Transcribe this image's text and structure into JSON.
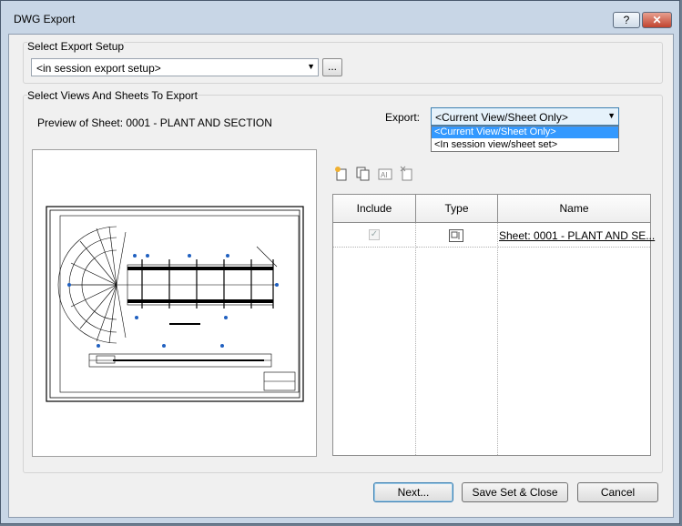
{
  "window": {
    "title": "DWG Export",
    "help_label": "?",
    "close_label": "✕"
  },
  "setup": {
    "group_label": "Select Export Setup",
    "combo_value": "<in session export setup>",
    "ellipsis_label": "..."
  },
  "views": {
    "group_label": "Select Views And Sheets To Export",
    "preview_label": "Preview of Sheet: 0001 - PLANT AND SECTION",
    "export_label": "Export:",
    "export_value": "<Current View/Sheet Only>",
    "export_options": [
      "<Current View/Sheet Only>",
      "<In session view/sheet set>"
    ]
  },
  "toolbar": {
    "icons": [
      "new-set-icon",
      "duplicate-set-icon",
      "rename-set-icon",
      "delete-set-icon"
    ]
  },
  "table": {
    "headers": [
      "Include",
      "Type",
      "Name"
    ],
    "rows": [
      {
        "include": true,
        "type_icon": "sheet-icon",
        "name": "Sheet: 0001 - PLANT AND SE..."
      }
    ]
  },
  "buttons": {
    "next": "Next...",
    "save_close": "Save Set & Close",
    "cancel": "Cancel"
  }
}
